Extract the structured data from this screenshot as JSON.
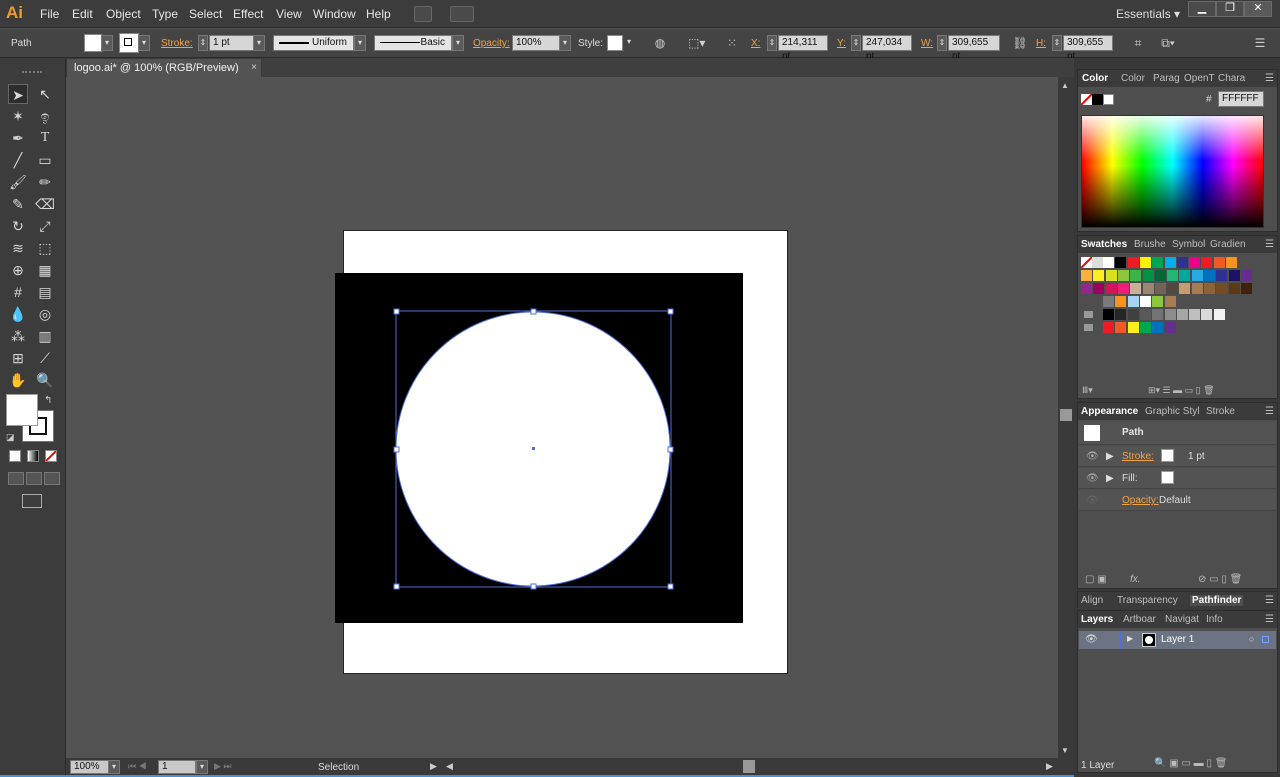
{
  "app": {
    "logo": "Ai"
  },
  "menu": [
    "File",
    "Edit",
    "Object",
    "Type",
    "Select",
    "Effect",
    "View",
    "Window",
    "Help"
  ],
  "workspace": "Essentials",
  "window_buttons": [
    "▁",
    "❐",
    "✕"
  ],
  "control": {
    "selection_type": "Path",
    "stroke_label": "Stroke:",
    "stroke_weight": "1 pt",
    "profile": "Uniform",
    "brush": "Basic",
    "opacity_label": "Opacity:",
    "opacity": "100%",
    "style_label": "Style:",
    "x_label": "X:",
    "x": "214,311 pt",
    "y_label": "Y:",
    "y": "247,034 pt",
    "w_label": "W:",
    "w": "309,655 pt",
    "h_label": "H:",
    "h": "309,655 pt"
  },
  "document": {
    "tab_title": "logoo.ai* @ 100% (RGB/Preview)",
    "close": "×"
  },
  "status": {
    "zoom": "100%",
    "artboard": "1",
    "tool": "Selection"
  },
  "panels": {
    "color_tabs": [
      "Color",
      "Color",
      "Parag",
      "OpenT",
      "Chara"
    ],
    "color_hex_label": "#",
    "color_hex": "FFFFFF",
    "swatches_tabs": [
      "Swatches",
      "Brushe",
      "Symbol",
      "Gradien"
    ],
    "appearance_tabs": [
      "Appearance",
      "Graphic Styl",
      "Stroke"
    ],
    "appearance_title": "Path",
    "appearance_stroke_label": "Stroke:",
    "appearance_stroke_value": "1 pt",
    "appearance_fill_label": "Fill:",
    "appearance_opacity_label": "Opacity:",
    "appearance_opacity_value": "Default",
    "appearance_fx": "fx.",
    "align_tabs": [
      "Align",
      "Transparency",
      "Pathfinder"
    ],
    "layers_tabs": [
      "Layers",
      "Artboar",
      "Navigat",
      "Info"
    ],
    "layer_name": "Layer 1",
    "layers_count": "1 Layer"
  },
  "swatch_rows": [
    [
      "#ffffff",
      "#000000",
      "#ed1c24",
      "#fff200",
      "#00a651",
      "#00aeef",
      "#2e3192",
      "#ec008c",
      "#ed1c24",
      "#f15a24",
      "#f7931e"
    ],
    [
      "#fbb03b",
      "#fcee21",
      "#d9e021",
      "#8cc63f",
      "#39b54a",
      "#009245",
      "#006837",
      "#22b573",
      "#00a99d",
      "#29abe2",
      "#0071bc",
      "#2e3192",
      "#1b1464",
      "#662d91"
    ],
    [
      "#93278f",
      "#9e005d",
      "#d4145a",
      "#ed1e79",
      "#c7b299",
      "#998675",
      "#736357",
      "#534741",
      "#c69c6d",
      "#a67c52",
      "#8c6239",
      "#754c24",
      "#603813",
      "#42210b"
    ],
    [
      "#7a7a7a",
      "#f7931e",
      "#a6d5f0",
      "#ffffff",
      "#8cc63f",
      "#a67c52"
    ],
    [
      "#000000",
      "#262626",
      "#404040",
      "#595959",
      "#737373",
      "#8c8c8c",
      "#a6a6a6",
      "#bfbfbf",
      "#d9d9d9",
      "#f2f2f2"
    ],
    [
      "#ed1c24",
      "#f15a24",
      "#fcee21",
      "#00a651",
      "#0071bc",
      "#662d91"
    ]
  ]
}
